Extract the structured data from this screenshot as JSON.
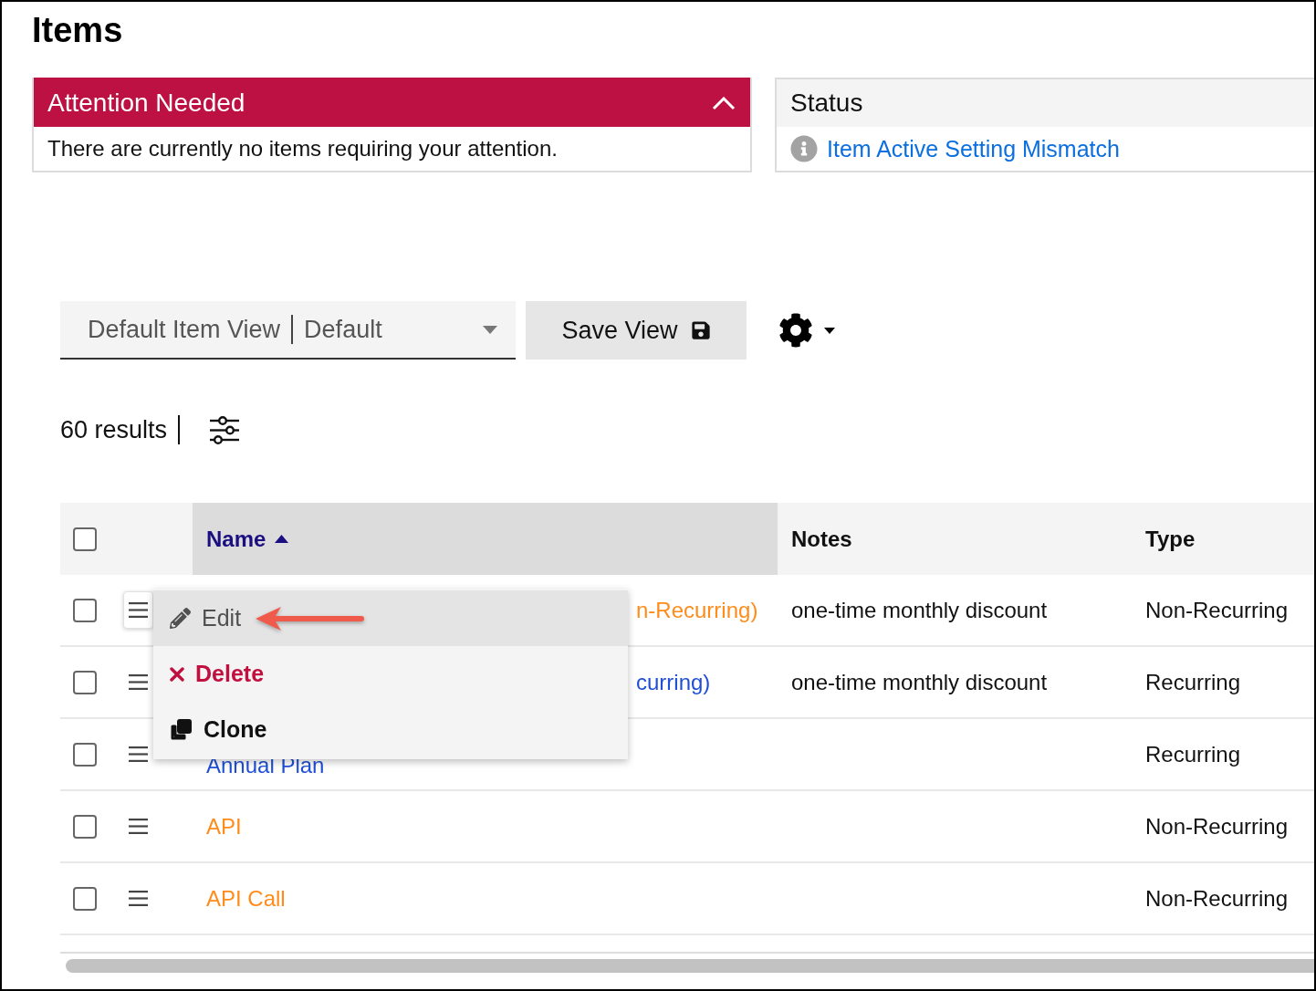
{
  "page": {
    "title": "Items"
  },
  "attention_panel": {
    "title": "Attention Needed",
    "expanded": true,
    "message": "There are currently no items requiring your attention."
  },
  "status_panel": {
    "title": "Status",
    "links": [
      {
        "label": "Item Active Setting Mismatch"
      }
    ]
  },
  "toolbar": {
    "view_select": {
      "view_name": "Default Item View",
      "view_scope": "Default"
    },
    "save_button": {
      "label": "Save View"
    }
  },
  "results": {
    "count": "60 results"
  },
  "table": {
    "select_all": {
      "checked": false
    },
    "columns": [
      {
        "label": "Name",
        "sorted": true,
        "ascending": true
      },
      {
        "label": "Notes",
        "sorted": false
      },
      {
        "label": "Type",
        "sorted": false
      }
    ],
    "rows": [
      {
        "checked": false,
        "menu_open": true,
        "name": "n-Recurring)",
        "color": "#ff8c1a",
        "notes": "one-time monthly discount",
        "type": "Non-Recurring"
      },
      {
        "checked": false,
        "menu_open": false,
        "name": "curring)",
        "color": "#1f4fd6",
        "notes": "one-time monthly discount",
        "type": "Recurring"
      },
      {
        "checked": false,
        "menu_open": false,
        "name": "Annual Plan",
        "color": "#1f4fd6",
        "type": "Recurring"
      },
      {
        "checked": false,
        "menu_open": false,
        "name": "API",
        "color": "#ff8c1a",
        "type": "Non-Recurring"
      },
      {
        "checked": false,
        "menu_open": false,
        "name": "API Call",
        "color": "#ff8c1a",
        "type": "Non-Recurring"
      }
    ],
    "row_menu": {
      "items": [
        {
          "kind": "edit",
          "label": "Edit",
          "selected": true
        },
        {
          "kind": "delete",
          "label": "Delete",
          "selected": false
        },
        {
          "kind": "clone",
          "label": "Clone",
          "selected": false
        }
      ]
    }
  }
}
